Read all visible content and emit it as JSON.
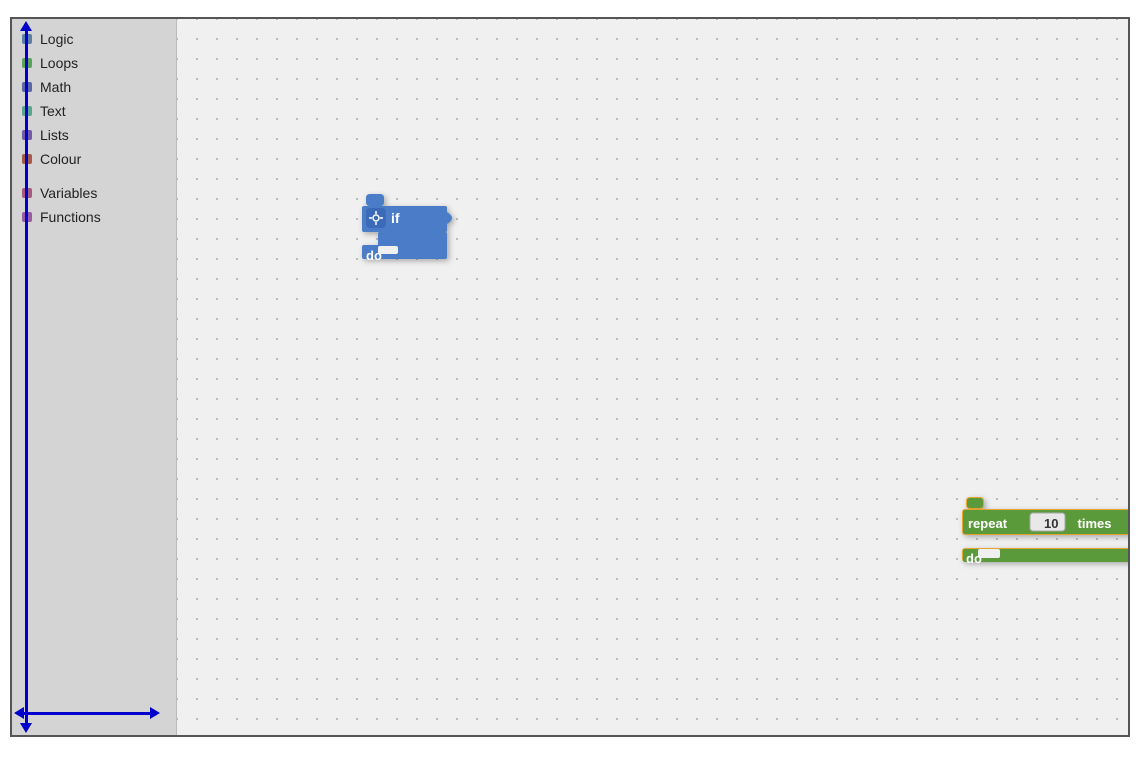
{
  "sidebar": {
    "items": [
      {
        "label": "Logic",
        "color": "#5b80a5",
        "id": "logic"
      },
      {
        "label": "Loops",
        "color": "#5ba55b",
        "id": "loops"
      },
      {
        "label": "Math",
        "color": "#5b67a5",
        "id": "math"
      },
      {
        "label": "Text",
        "color": "#5ba58c",
        "id": "text"
      },
      {
        "label": "Lists",
        "color": "#745ba5",
        "id": "lists"
      },
      {
        "label": "Colour",
        "color": "#a55b45",
        "id": "colour"
      }
    ],
    "items2": [
      {
        "label": "Variables",
        "color": "#a55b80",
        "id": "variables"
      },
      {
        "label": "Functions",
        "color": "#9a5ba5",
        "id": "functions"
      }
    ]
  },
  "blocks": {
    "if_block": {
      "label_if": "if",
      "label_do": "do"
    },
    "repeat_block": {
      "label_repeat": "repeat",
      "label_times": "times",
      "label_do": "do",
      "value": "10"
    }
  }
}
